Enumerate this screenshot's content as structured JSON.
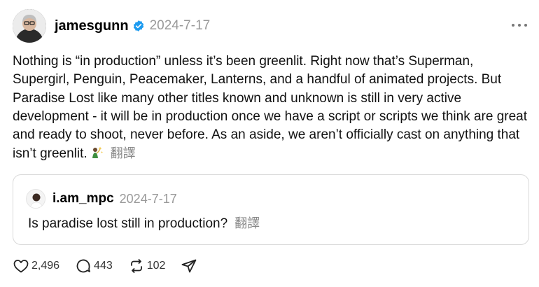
{
  "post": {
    "username": "jamesgunn",
    "timestamp": "2024-7-17",
    "text": "Nothing is “in production” unless it’s been greenlit. Right now that’s Superman, Supergirl, Penguin, Peacemaker, Lanterns, and a handful of animated projects. But Paradise Lost like many other titles known and unknown is still in very active development - it will be in production once we have a script or scripts we think are great and ready to shoot, never before. As an aside, we aren’t officially cast on anything that isn’t greenlit.",
    "translate_label": "翻譯",
    "emoji": "sparkles-icon"
  },
  "quote": {
    "username": "i.am_mpc",
    "timestamp": "2024-7-17",
    "text": "Is paradise lost still in production?",
    "translate_label": "翻譯"
  },
  "actions": {
    "likes": "2,496",
    "comments": "443",
    "reposts": "102"
  },
  "colors": {
    "verified": "#1d9bf0",
    "muted": "#999999"
  }
}
